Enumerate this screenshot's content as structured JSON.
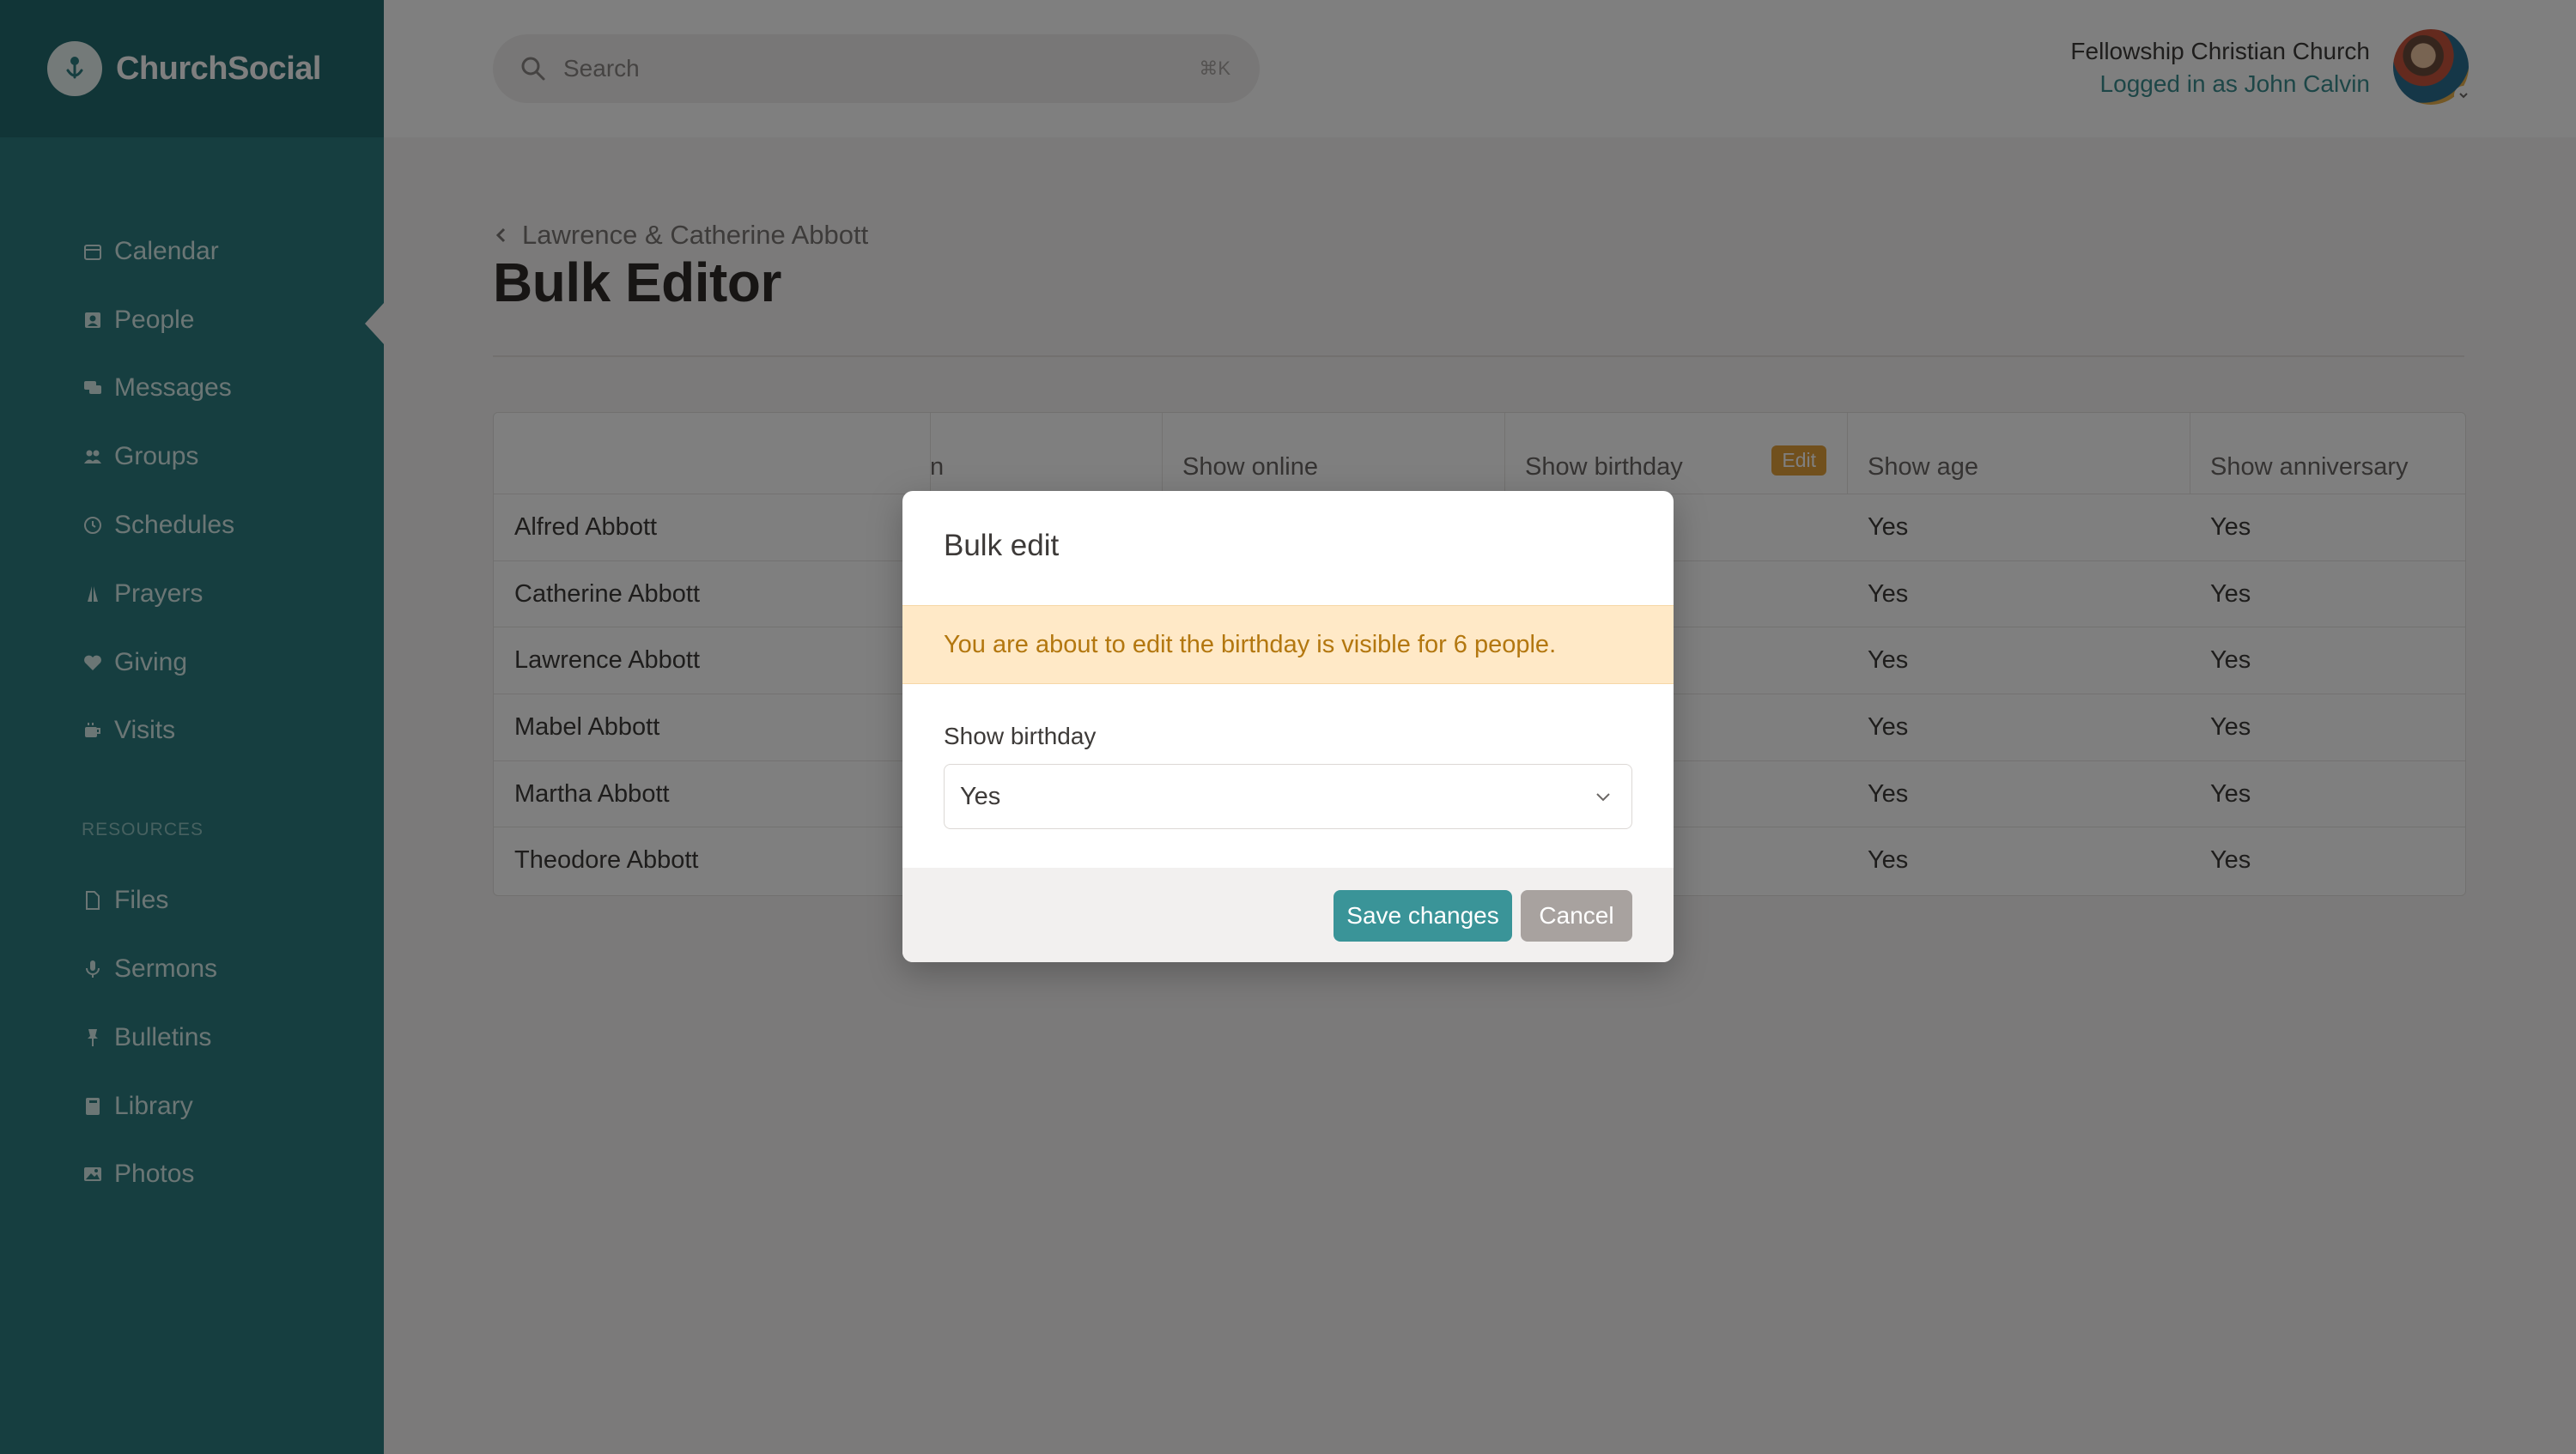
{
  "app": {
    "name": "ChurchSocial"
  },
  "sidebar": {
    "items": [
      {
        "label": "Calendar",
        "icon": "calendar-icon"
      },
      {
        "label": "People",
        "icon": "people-icon"
      },
      {
        "label": "Messages",
        "icon": "messages-icon"
      },
      {
        "label": "Groups",
        "icon": "groups-icon"
      },
      {
        "label": "Schedules",
        "icon": "clock-icon"
      },
      {
        "label": "Prayers",
        "icon": "praying-hands-icon"
      },
      {
        "label": "Giving",
        "icon": "heart-icon"
      },
      {
        "label": "Visits",
        "icon": "coffee-icon"
      }
    ],
    "section_label": "RESOURCES",
    "resources": [
      {
        "label": "Files",
        "icon": "file-icon"
      },
      {
        "label": "Sermons",
        "icon": "microphone-icon"
      },
      {
        "label": "Bulletins",
        "icon": "pin-icon"
      },
      {
        "label": "Library",
        "icon": "book-icon"
      },
      {
        "label": "Photos",
        "icon": "image-icon"
      }
    ]
  },
  "header": {
    "search_placeholder": "Search",
    "search_shortcut": "⌘K",
    "org_name": "Fellowship Christian Church",
    "logged_in_as": "Logged in as John Calvin"
  },
  "page": {
    "breadcrumb": "Lawrence & Catherine Abbott",
    "title": "Bulk Editor"
  },
  "table": {
    "columns": [
      "",
      "n",
      "Show online",
      "Show birthday",
      "Show age",
      "Show anniversary"
    ],
    "edit_badge": "Edit",
    "rows": [
      {
        "name": "Alfred Abbott",
        "show_age": "Yes",
        "show_anniversary": "Yes"
      },
      {
        "name": "Catherine Abbott",
        "show_age": "Yes",
        "show_anniversary": "Yes"
      },
      {
        "name": "Lawrence Abbott",
        "show_age": "Yes",
        "show_anniversary": "Yes"
      },
      {
        "name": "Mabel Abbott",
        "show_age": "Yes",
        "show_anniversary": "Yes"
      },
      {
        "name": "Martha Abbott",
        "show_age": "Yes",
        "show_anniversary": "Yes"
      },
      {
        "name": "Theodore Abbott",
        "show_age": "Yes",
        "show_anniversary": "Yes"
      }
    ]
  },
  "modal": {
    "title": "Bulk edit",
    "alert": "You are about to edit the birthday is visible for 6 people.",
    "field_label": "Show birthday",
    "selected_value": "Yes",
    "save_label": "Save changes",
    "cancel_label": "Cancel"
  },
  "colors": {
    "sidebar": "#2d7c80",
    "accent": "#3a9498",
    "alert_bg": "#ffe9c7",
    "alert_text": "#b3770f",
    "edit_badge": "#e3a03a"
  }
}
